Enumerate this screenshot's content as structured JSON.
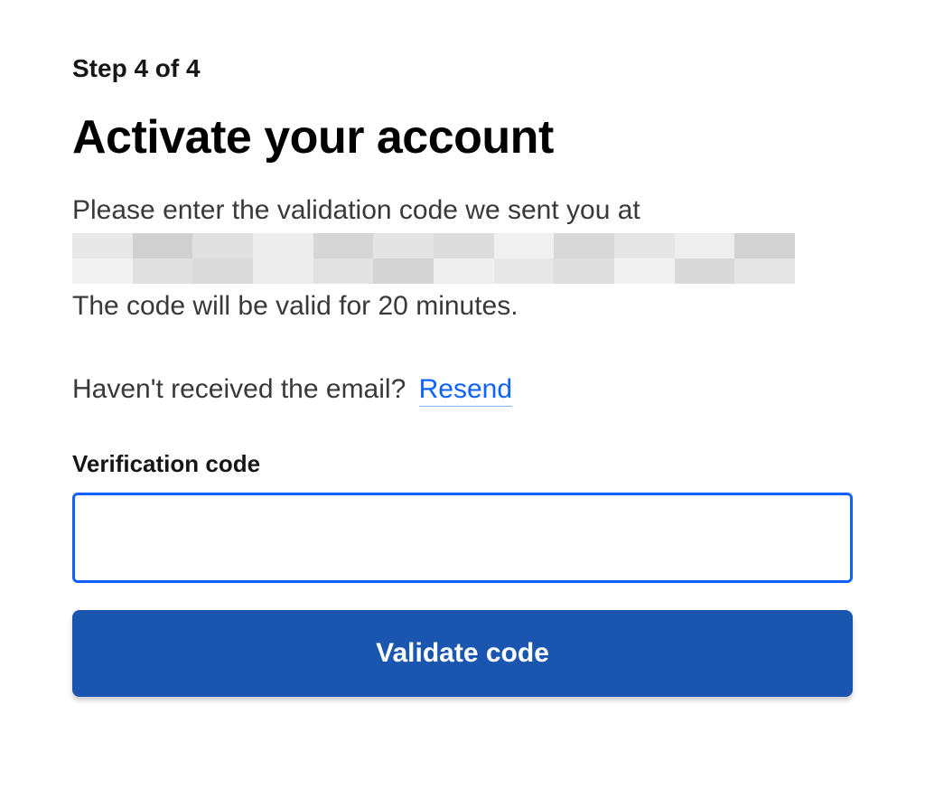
{
  "step": {
    "label": "Step 4 of 4"
  },
  "header": {
    "title": "Activate your account"
  },
  "instruction": {
    "line1": "Please enter the validation code we sent you at",
    "validity": "The code will be valid for 20 minutes."
  },
  "resend": {
    "prompt": "Haven't received the email?",
    "link_label": "Resend"
  },
  "form": {
    "code_label": "Verification code",
    "code_value": "",
    "submit_label": "Validate code"
  },
  "colors": {
    "primary": "#0f62fe",
    "button_bg": "#1a56b0",
    "text": "#161616",
    "muted": "#393939"
  }
}
